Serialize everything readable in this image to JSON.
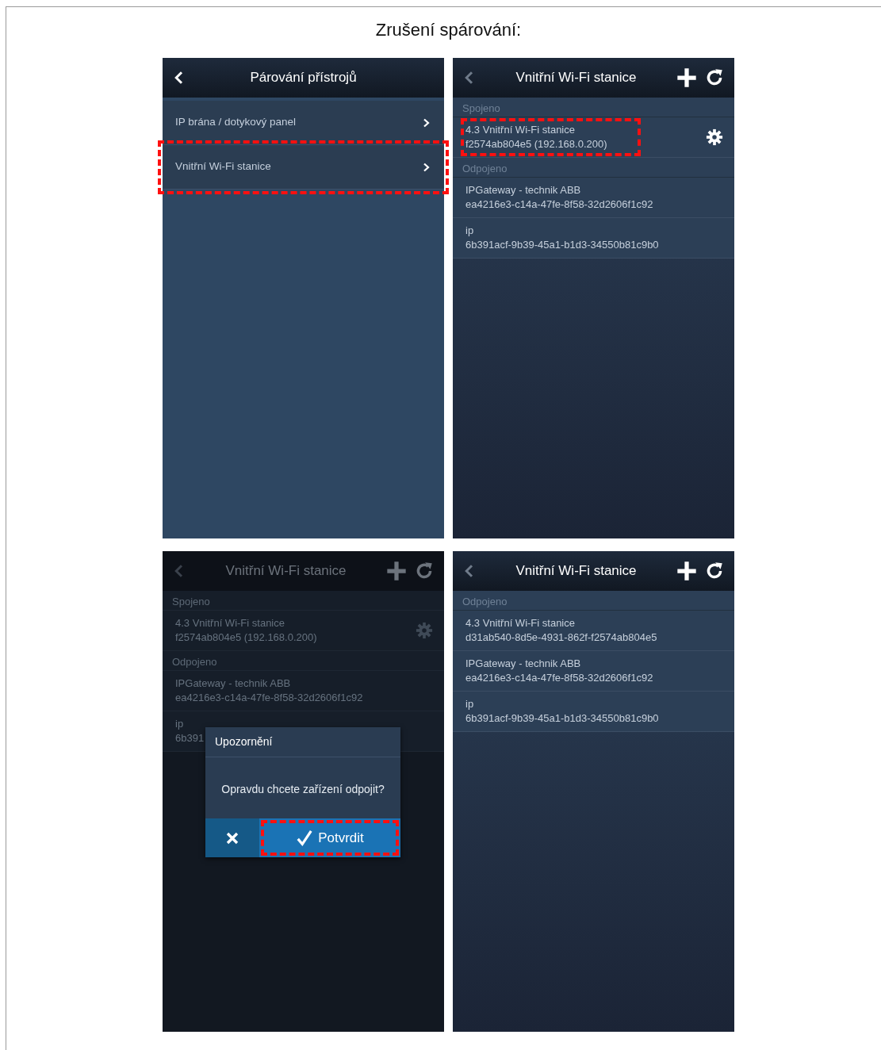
{
  "page_title": "Zrušení spárování:",
  "screens": [
    {
      "kind": "menu",
      "dimmed": false,
      "header": {
        "title": "Párování přístrojů",
        "back_enabled": true,
        "actions": false
      },
      "items": [
        {
          "label": "IP brána / dotykový panel",
          "highlighted": false
        },
        {
          "label": "Vnitřní Wi-Fi stanice",
          "highlighted": true
        }
      ]
    },
    {
      "kind": "devices",
      "dimmed": false,
      "header": {
        "title": "Vnitřní Wi-Fi stanice",
        "back_enabled": false,
        "actions": true
      },
      "sections": [
        {
          "heading": "Spojeno",
          "items": [
            {
              "name": "4.3 Vnitřní Wi-Fi stanice",
              "detail": "f2574ab804e5 (192.168.0.200)",
              "settings": true,
              "highlighted": true
            }
          ]
        },
        {
          "heading": "Odpojeno",
          "items": [
            {
              "name": "IPGateway - technik ABB",
              "detail": "ea4216e3-c14a-47fe-8f58-32d2606f1c92",
              "settings": false,
              "highlighted": false
            },
            {
              "name": "ip",
              "detail": "6b391acf-9b39-45a1-b1d3-34550b81c9b0",
              "settings": false,
              "highlighted": false
            }
          ]
        }
      ]
    },
    {
      "kind": "devices",
      "dimmed": true,
      "header": {
        "title": "Vnitřní Wi-Fi stanice",
        "back_enabled": false,
        "actions": true
      },
      "sections": [
        {
          "heading": "Spojeno",
          "items": [
            {
              "name": "4.3 Vnitřní Wi-Fi stanice",
              "detail": "f2574ab804e5 (192.168.0.200)",
              "settings": true,
              "highlighted": false
            }
          ]
        },
        {
          "heading": "Odpojeno",
          "items": [
            {
              "name": "IPGateway - technik ABB",
              "detail": "ea4216e3-c14a-47fe-8f58-32d2606f1c92",
              "settings": false,
              "highlighted": false
            },
            {
              "name": "ip",
              "detail": "6b391",
              "settings": false,
              "highlighted": false
            }
          ]
        }
      ],
      "dialog": {
        "title": "Upozornění",
        "message": "Opravdu chcete zařízení odpojit?",
        "buttons": [
          {
            "kind": "cancel",
            "highlighted": false
          },
          {
            "kind": "confirm",
            "label": "Potvrdit",
            "highlighted": true
          }
        ]
      }
    },
    {
      "kind": "devices",
      "dimmed": false,
      "header": {
        "title": "Vnitřní Wi-Fi stanice",
        "back_enabled": false,
        "actions": true
      },
      "sections": [
        {
          "heading": "Odpojeno",
          "items": [
            {
              "name": "4.3 Vnitřní Wi-Fi stanice",
              "detail": "d31ab540-8d5e-4931-862f-f2574ab804e5",
              "settings": false,
              "highlighted": false
            },
            {
              "name": "IPGateway - technik ABB",
              "detail": "ea4216e3-c14a-47fe-8f58-32d2606f1c92",
              "settings": false,
              "highlighted": false
            },
            {
              "name": "ip",
              "detail": "6b391acf-9b39-45a1-b1d3-34550b81c9b0",
              "settings": false,
              "highlighted": false
            }
          ]
        }
      ]
    }
  ]
}
